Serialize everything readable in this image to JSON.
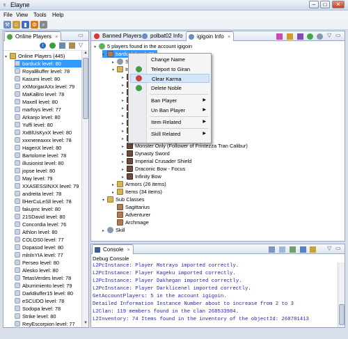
{
  "window": {
    "title": "Elayne",
    "min": "0",
    "max": "1",
    "close": "r"
  },
  "menu": [
    "File",
    "View",
    "Tools",
    "Help"
  ],
  "left": {
    "tab_label": "Online Players",
    "root_label": "Online Players (445)",
    "players": [
      "barduck level: 80",
      "RoyalBuffer level: 78",
      "Kasumi level: 80",
      "xXMorgarAXx level: 79",
      "MaKaBro level: 78",
      "Maxell level: 80",
      "marfoys level: 77",
      "Arkanjo level: 80",
      "Yuffi level: 80",
      "XxBlUsKyxX level: 80",
      "xxxnereaxxx level: 78",
      "HagenX level: 80",
      "Bartolome level: 78",
      "illusionist level: 80",
      "jopse level: 80",
      "May level: 79",
      "XXASESSINXX level: 79",
      "andreita level: 78",
      "llHerCuLeSll level: 78",
      "fakujmc level: 80",
      "21SDavid level: 80",
      "Concordia level: 76",
      "Athlon level: 80",
      "COLOS0 level: 77",
      "Dopasod level: 80",
      "mlnlnYIA level: 77",
      "Perseo level: 80",
      "Alesko level: 80",
      "TetasVerdes level: 78",
      "Aburrimiento level: 79",
      "DarkBuffer15 level: 80",
      "eSCUDO level: 78",
      "Sodopa level: 78",
      "Strike level: 80",
      "ReyEscorpion level: 77"
    ]
  },
  "editor": {
    "tabs": [
      "Banned Players",
      "polbat02 Info",
      "igigoin Info"
    ],
    "close_glyph": "×",
    "root": "5 players found in the account igigoin",
    "selected_char": "barduck level: 80",
    "nodes": {
      "stats": "Stats",
      "inventory": "Inventory",
      "subclasses": "Sub Classes",
      "skill": "Skill",
      "armors": "Armors (26 items)",
      "items": "Items (34 items)"
    },
    "weapons": [
      "Draconic Bow - Focus",
      "Monster Only (Follower of Frintezza Tran Calibur)",
      "Dynasty Sword",
      "Imperial Crusader Shield",
      "Draconic Bow - Focus",
      "Infinity Bow"
    ],
    "subs": [
      "Sagittarius",
      "Adventurer",
      "Archmage"
    ]
  },
  "context_menu": {
    "items": [
      "Change Name",
      "Teleport to Giran",
      "Clear Karma",
      "Delete Noble",
      "Ban Player",
      "Un Ban Player",
      "Item Related",
      "Skill Related"
    ],
    "submenu_arrow": "▶"
  },
  "console": {
    "tab_label": "Console",
    "header": "Debug Console",
    "lines": [
      "L2PcInstance: Player Motrayo imported correctly.",
      "L2PcInstance: Player Kageku imported correctly.",
      "L2PcInstance: Player Dakhegan imported correctly.",
      "L2PcInstance: Player Darklicenel imported correctly.",
      "GetAccountPlayers: 5 in the account igigoin.",
      "Detailed Information Instance Number about to increase from 2 to 3",
      "L2Clan: 119 members found in the clan 268533984.",
      "L2Inventory: 74 Items found in the inventory of the objectId: 268781413"
    ]
  },
  "colors": {
    "accent": "#3399ff",
    "console_text": "#1f1fb0",
    "highlight": "#d7e6f7"
  }
}
